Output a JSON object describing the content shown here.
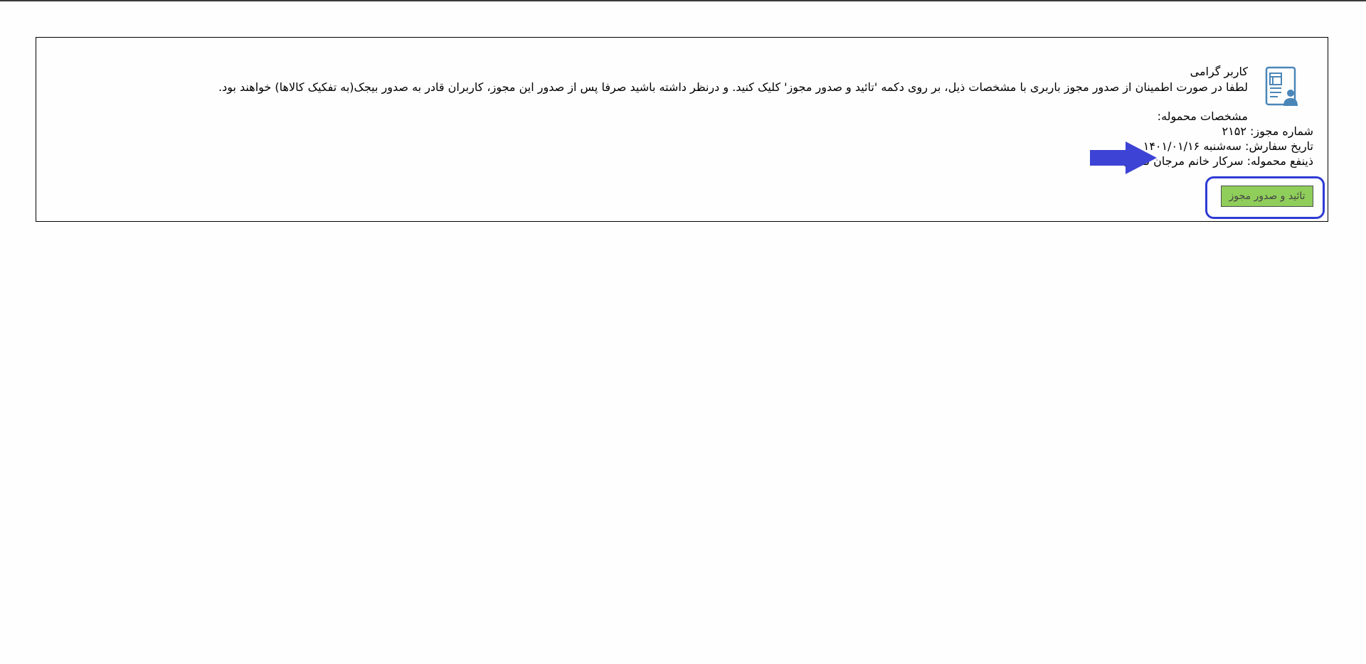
{
  "notice": {
    "greeting": "کاربر گرامی",
    "message": "لطفا در صورت اطمینان از صدور مجوز باربری با مشخصات ذیل، بر روی دکمه 'تائید و صدور مجوز' کلیک کنید. و درنظر داشته باشید صرفا پس از صدور این مجوز، کاربران قادر به صدور بیجک(به تفکیک کالاها) خواهند بود.",
    "specs_title": "مشخصات محموله:",
    "permit_number": "شماره مجوز: ۲۱۵۲",
    "order_date": "تاریخ سفارش: سه‌شنبه ۱۴۰۱/۰۱/۱۶",
    "beneficiary": "ذینفع محموله: سرکار خانم مرجان فدایی",
    "confirm_button": "تائید و صدور مجوز",
    "icon": "user-document-icon",
    "arrow_icon": "arrow-right-icon",
    "accent_color": "#2f3bd4",
    "button_color": "#8fce5a"
  }
}
